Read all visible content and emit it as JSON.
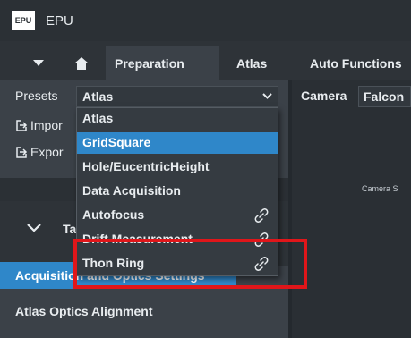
{
  "app": {
    "logo_text": "EPU",
    "title": "EPU"
  },
  "tabs": [
    {
      "label": "Preparation",
      "active": true
    },
    {
      "label": "Atlas",
      "active": false
    },
    {
      "label": "Auto Functions",
      "active": false
    }
  ],
  "tab_controls": {
    "menu_icon": "caret-down-icon",
    "home_icon": "home-icon"
  },
  "presets": {
    "label": "Presets",
    "selected": "Atlas"
  },
  "camera": {
    "label": "Camera",
    "value": "Falcon"
  },
  "toolbar": {
    "import_label": "Impor",
    "export_label": "Expor"
  },
  "dropdown_items": [
    {
      "label": "Atlas",
      "selected": false,
      "linked": false
    },
    {
      "label": "GridSquare",
      "selected": true,
      "linked": false
    },
    {
      "label": "Hole/EucentricHeight",
      "selected": false,
      "linked": false
    },
    {
      "label": "Data Acquisition",
      "selected": false,
      "linked": false
    },
    {
      "label": "Autofocus",
      "selected": false,
      "linked": true
    },
    {
      "label": "Drift Measurement",
      "selected": false,
      "linked": true
    },
    {
      "label": "Thon Ring",
      "selected": false,
      "linked": true
    }
  ],
  "camera_strip_text": "Camera S",
  "task_section": {
    "partial_label": "Ta"
  },
  "nav_items": [
    {
      "label": "Acquisition and Optics Settings",
      "active": true
    },
    {
      "label": "Atlas Optics Alignment",
      "active": false
    }
  ],
  "colors": {
    "accent": "#2f87c9",
    "highlight_box": "#e0161a",
    "panel": "#3b4148",
    "background": "#2e3338"
  }
}
